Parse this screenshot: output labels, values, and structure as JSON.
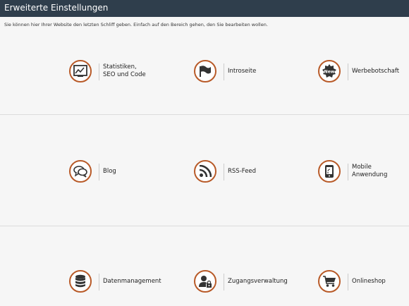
{
  "header": {
    "title": "Erweiterte Einstellungen"
  },
  "intro": "Sie können hier Ihrer Website den letzten Schliff geben. Einfach auf den  Bereich gehen, den Sie bearbeiten wollen.",
  "accent_color": "#b85a28",
  "tiles": [
    {
      "label": "Statistiken,\nSEO und Code",
      "icon": "chart-icon"
    },
    {
      "label": "Introseite",
      "icon": "flag-icon"
    },
    {
      "label": "Werbebotschaft",
      "icon": "new-badge-icon"
    },
    {
      "label": "Blog",
      "icon": "speech-bubbles-icon"
    },
    {
      "label": "RSS-Feed",
      "icon": "rss-icon"
    },
    {
      "label": "Mobile\nAnwendung",
      "icon": "mobile-phone-icon"
    },
    {
      "label": "Datenmanagement",
      "icon": "database-icon"
    },
    {
      "label": "Zugangsverwaltung",
      "icon": "user-lock-icon"
    },
    {
      "label": "Onlineshop",
      "icon": "shopping-cart-icon"
    }
  ]
}
